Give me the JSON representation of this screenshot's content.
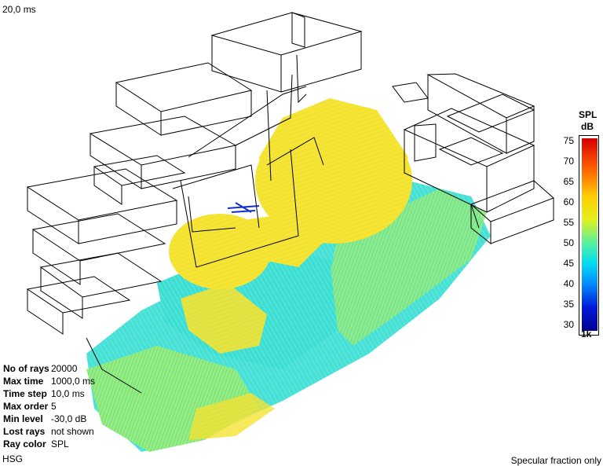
{
  "view": {
    "time_readout": "20,0 ms",
    "software_label": "HSG",
    "mode_label": "Specular fraction only"
  },
  "info_panel": [
    {
      "key": "No of rays",
      "value": "20000"
    },
    {
      "key": "Max time",
      "value": "1000,0 ms"
    },
    {
      "key": "Time step",
      "value": "10,0 ms"
    },
    {
      "key": "Max order",
      "value": "5"
    },
    {
      "key": "Min level",
      "value": "-30,0 dB"
    },
    {
      "key": "Lost rays",
      "value": "not shown"
    },
    {
      "key": "Ray color",
      "value": "SPL"
    }
  ],
  "legend": {
    "title_line1": "SPL",
    "title_line2": "dB",
    "frequency": "1k",
    "ticks": [
      "75",
      "70",
      "65",
      "60",
      "55",
      "50",
      "45",
      "40",
      "35",
      "30"
    ],
    "scale_min": 30,
    "scale_max": 75
  },
  "colors": {
    "ray_high": "#ffe600",
    "ray_mid": "#c8f040",
    "ray_low": "#2ee0e0",
    "wireframe": "#000000"
  }
}
